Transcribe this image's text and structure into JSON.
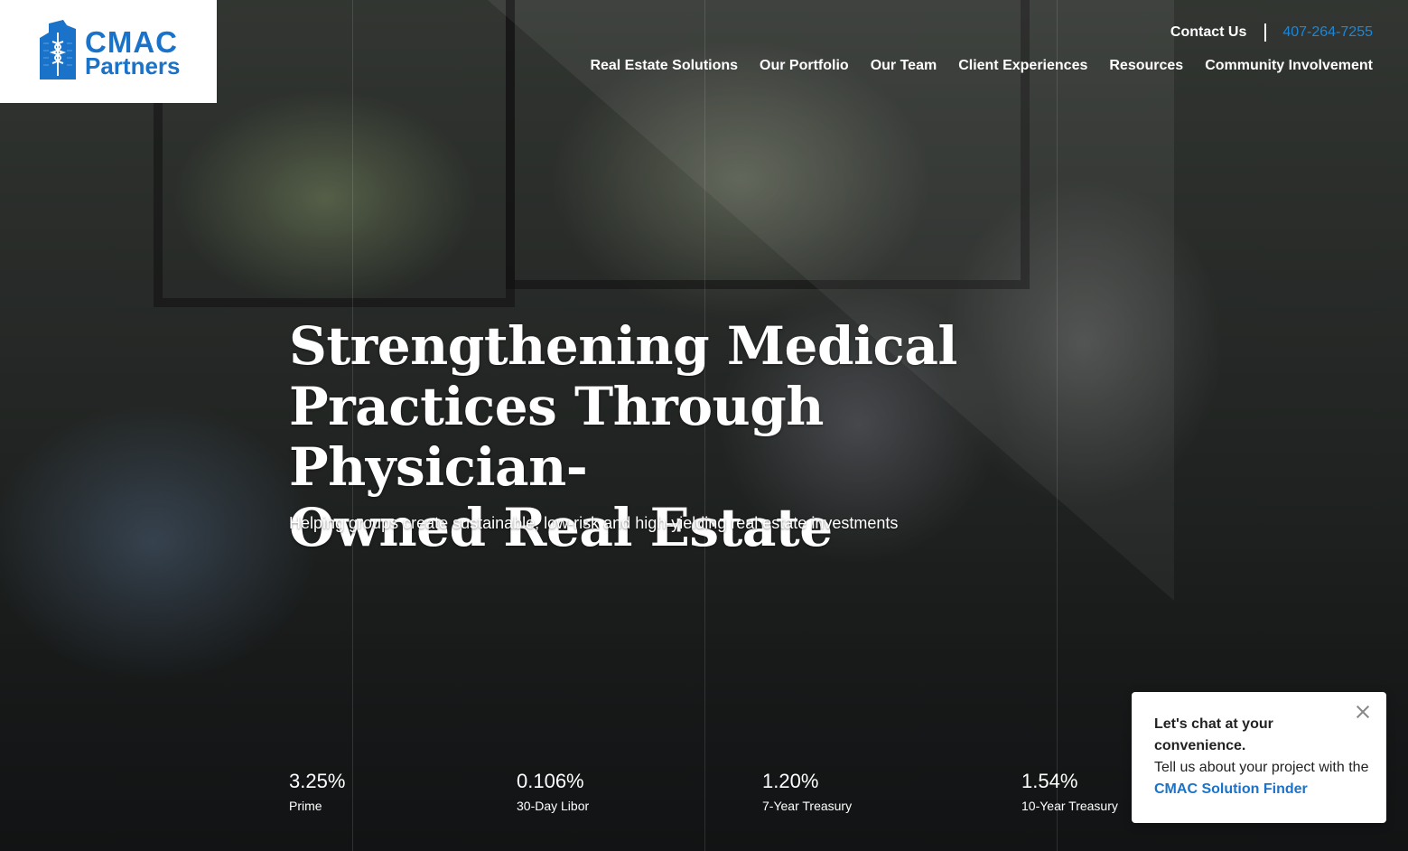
{
  "brand": {
    "logo_line1": "CMAC",
    "logo_line2": "Partners",
    "color": "#1a73c8"
  },
  "topbar": {
    "contact_label": "Contact Us",
    "phone": "407-264-7255"
  },
  "nav": {
    "items": [
      {
        "label": "Real Estate Solutions"
      },
      {
        "label": "Our Portfolio"
      },
      {
        "label": "Our Team"
      },
      {
        "label": "Client Experiences"
      },
      {
        "label": "Resources"
      },
      {
        "label": "Community Involvement"
      }
    ]
  },
  "hero": {
    "headline_line1": "Strengthening Medical",
    "headline_line2": "Practices Through Physician-",
    "headline_line3": "Owned Real Estate",
    "subtitle": "Helping groups create sustainable, low-risk and high-yielding real estate investments"
  },
  "rates": [
    {
      "value": "3.25%",
      "label": "Prime"
    },
    {
      "value": "0.106%",
      "label": "30-Day Libor"
    },
    {
      "value": "1.20%",
      "label": "7-Year Treasury"
    },
    {
      "value": "1.54%",
      "label": "10-Year Treasury"
    }
  ],
  "chat": {
    "title": "Let's chat at your convenience.",
    "body_prefix": "Tell us about your project with the",
    "link_text": "CMAC Solution Finder",
    "close_icon": "close-icon"
  }
}
